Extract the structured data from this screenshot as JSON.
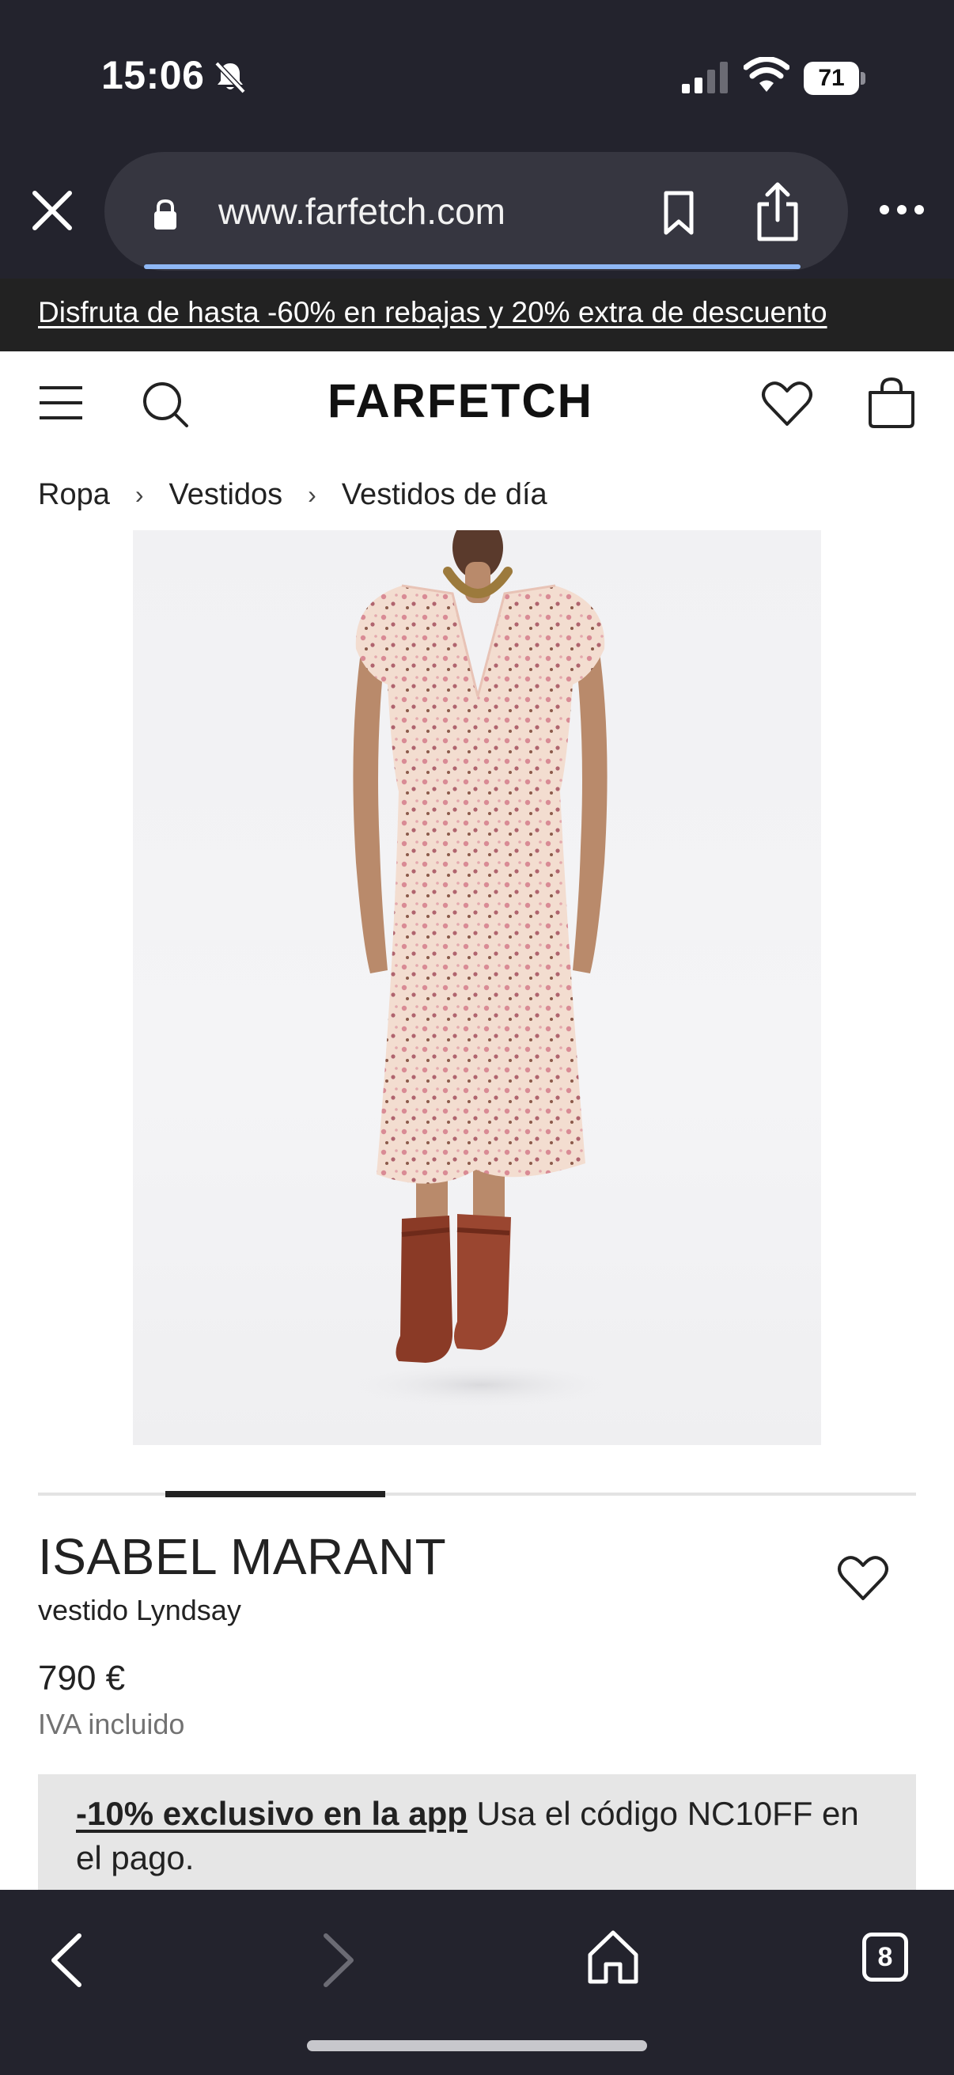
{
  "status_bar": {
    "time": "15:06",
    "battery": "71",
    "icons": [
      "bell-slash-icon",
      "signal-icon",
      "wifi-icon",
      "battery-icon"
    ]
  },
  "browser": {
    "url": "www.farfetch.com",
    "page_load_progress": 0.86,
    "open_tabs_count": "8",
    "icons": [
      "close-icon",
      "lock-icon",
      "bookmark-icon",
      "share-icon",
      "more-icon",
      "back-icon",
      "forward-icon",
      "home-icon",
      "tabs-icon"
    ]
  },
  "promo_banner": {
    "text": "Disfruta de hasta -60% en rebajas y 20% extra de descuento"
  },
  "header": {
    "logo": "FARFETCH",
    "icons": [
      "menu-icon",
      "search-icon",
      "wishlist-icon",
      "shopping-bag-icon"
    ]
  },
  "breadcrumb": [
    {
      "label": "Ropa"
    },
    {
      "label": "Vestidos"
    },
    {
      "label": "Vestidos de día"
    }
  ],
  "gallery": {
    "active_index": 1,
    "total": 4
  },
  "product": {
    "brand": "ISABEL MARANT",
    "name": "vestido Lyndsay",
    "price": "790 €",
    "tax_note": "IVA incluido"
  },
  "app_promo": {
    "link_text": "-10% exclusivo en la app",
    "text": " Usa el código NC10FF en el pago."
  },
  "colors": {
    "chrome_bg": "#23232d",
    "url_pill_bg": "#363640",
    "promo_bg": "#222222",
    "app_promo_bg": "#e6e6e6",
    "text": "#222222",
    "muted_text": "#727272"
  }
}
